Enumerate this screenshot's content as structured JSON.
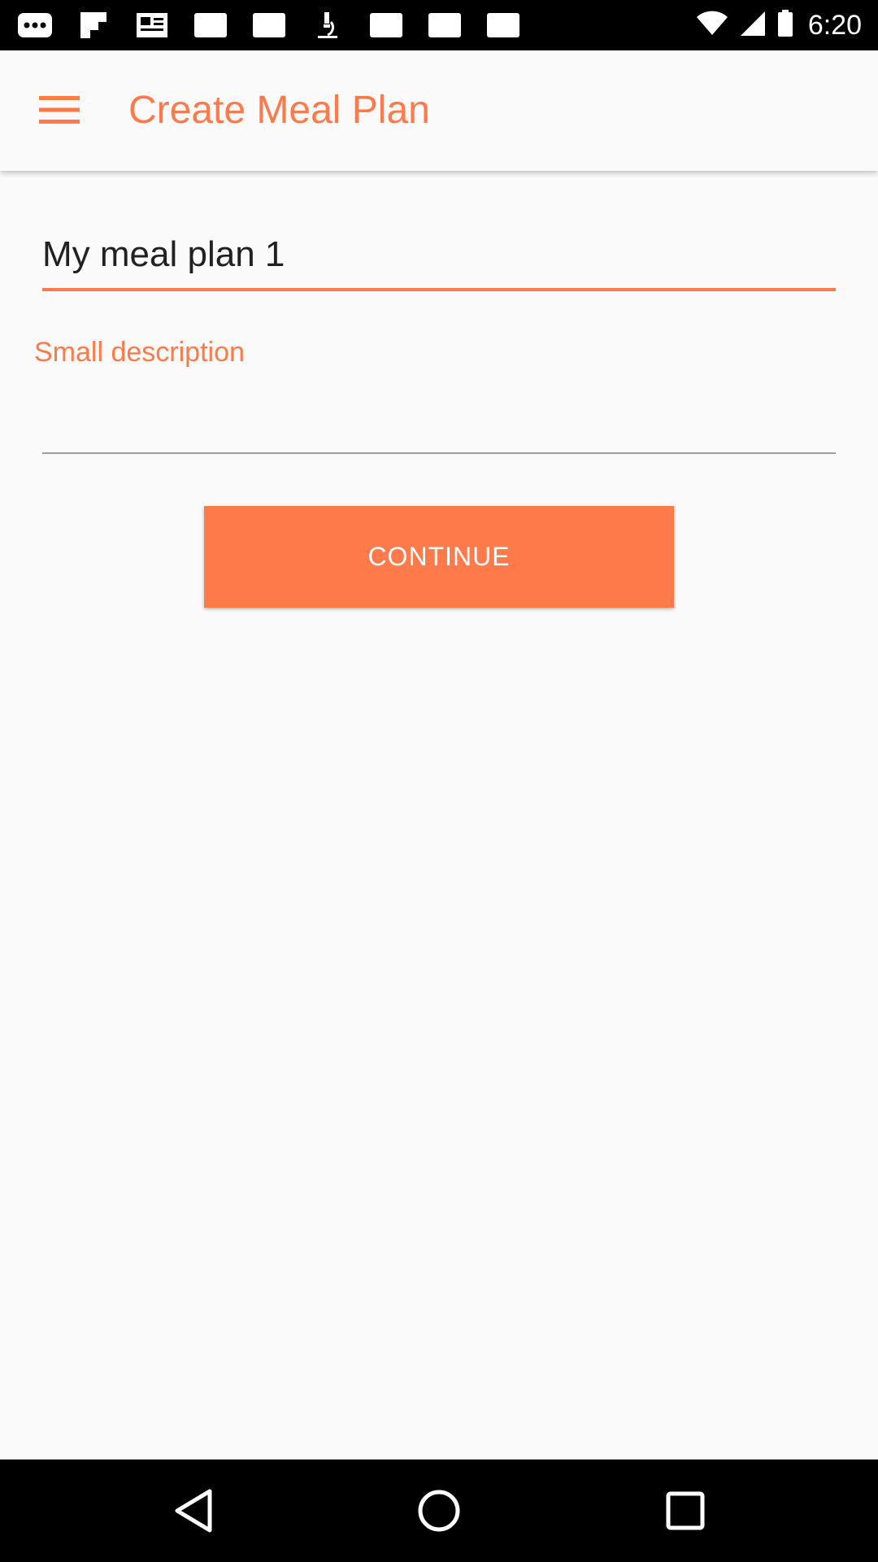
{
  "status_bar": {
    "time": "6:20",
    "left_icons": [
      "more-dots-icon",
      "flipboard-icon",
      "news-icon",
      "square-icon",
      "square-icon",
      "microscope-icon",
      "square-icon",
      "square-icon",
      "square-icon"
    ],
    "right_icons": [
      "wifi-icon",
      "cellular-signal-icon",
      "battery-icon"
    ]
  },
  "app_bar": {
    "menu_icon": "hamburger-menu-icon",
    "title": "Create Meal Plan"
  },
  "form": {
    "name_value": "My meal plan 1",
    "description_label": "Small description",
    "description_value": "",
    "continue_label": "CONTINUE"
  },
  "nav_bar": {
    "buttons": [
      "back-icon",
      "home-icon",
      "recents-icon"
    ]
  },
  "colors": {
    "accent": "#ff7a4a",
    "background": "#fafafa",
    "text": "#212121"
  }
}
